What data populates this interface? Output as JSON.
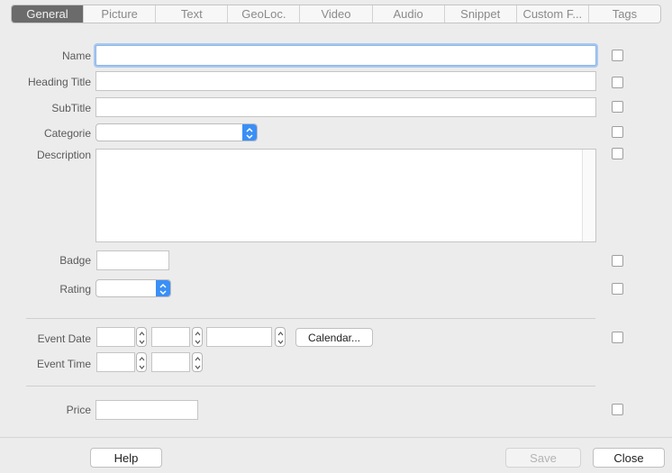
{
  "tabs": [
    {
      "label": "General",
      "active": true
    },
    {
      "label": "Picture"
    },
    {
      "label": "Text"
    },
    {
      "label": "GeoLoc."
    },
    {
      "label": "Video"
    },
    {
      "label": "Audio"
    },
    {
      "label": "Snippet"
    },
    {
      "label": "Custom F..."
    },
    {
      "label": "Tags"
    }
  ],
  "form": {
    "name_label": "Name",
    "name_value": "",
    "heading_title_label": "Heading Title",
    "heading_title_value": "",
    "subtitle_label": "SubTitle",
    "subtitle_value": "",
    "categorie_label": "Categorie",
    "categorie_value": "",
    "description_label": "Description",
    "description_value": "",
    "badge_label": "Badge",
    "badge_value": "",
    "rating_label": "Rating",
    "rating_value": "",
    "event_date_label": "Event Date",
    "event_time_label": "Event Time",
    "calendar_button": "Calendar...",
    "price_label": "Price",
    "price_value": ""
  },
  "footer": {
    "help_button": "Help",
    "save_button": "Save",
    "close_button": "Close"
  },
  "colors": {
    "accent": "#3a8ff6",
    "focus_ring": "#a7c8f0",
    "active_tab": "#6b6b6b"
  }
}
